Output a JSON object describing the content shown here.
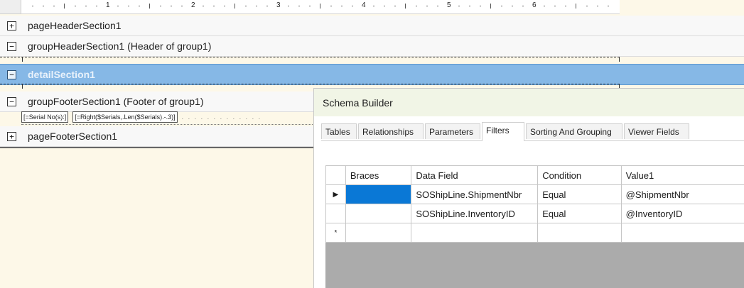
{
  "ruler": {
    "numbers": [
      "1",
      "2",
      "3",
      "4",
      "5",
      "6"
    ]
  },
  "sections": {
    "page_header": {
      "toggle": "+",
      "title": "pageHeaderSection1"
    },
    "group_header": {
      "toggle": "−",
      "title": "groupHeaderSection1 (Header of group1)"
    },
    "detail": {
      "toggle": "−",
      "title": "detailSection1"
    },
    "group_footer": {
      "toggle": "−",
      "title": "groupFooterSection1 (Footer of group1)"
    },
    "page_footer": {
      "toggle": "+",
      "title": "pageFooterSection1"
    }
  },
  "footer_fields": {
    "field1": "[=Serial No(s):]",
    "field2": "[=Right($Serials,.Len($Serials).-.3)]"
  },
  "dialog": {
    "title": "Schema Builder",
    "tabs": [
      "Tables",
      "Relationships",
      "Parameters",
      "Filters",
      "Sorting And Grouping",
      "Viewer Fields"
    ],
    "active_tab": "Filters"
  },
  "grid": {
    "columns": [
      "Braces",
      "Data Field",
      "Condition",
      "Value1"
    ],
    "rows": [
      {
        "indicator": "▶",
        "braces": "",
        "data_field": "SOShipLine.ShipmentNbr",
        "condition": "Equal",
        "value1": "@ShipmentNbr"
      },
      {
        "indicator": "",
        "braces": "",
        "data_field": "SOShipLine.InventoryID",
        "condition": "Equal",
        "value1": "@InventoryID"
      },
      {
        "indicator": "*",
        "braces": "",
        "data_field": "",
        "condition": "",
        "value1": ""
      }
    ]
  },
  "colors": {
    "selected_section": "#86b8e6",
    "selected_cell": "#0a78d6",
    "dialog_title_bg": "#f1f5e6"
  }
}
